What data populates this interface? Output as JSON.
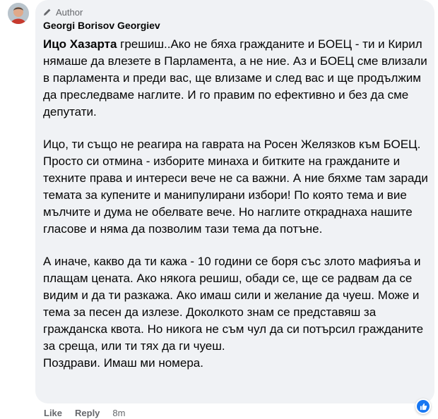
{
  "comment": {
    "author_badge": "Author",
    "author_name": "Georgi Borisov Georgiev",
    "mention": "Ицо Хазарта",
    "paragraphs": [
      "грешиш..Ако не бяха гражданите и БОЕЦ - ти и Кирил нямаше да влезете в Парламента, а не ние. Аз и БОЕЦ сме влизали в парламента и преди вас, ще влизаме и след вас и ще продължим да преследваме наглите. И го правим по ефективно и без да сме депутати.",
      "Ицо, ти също не реагира на гаврата на Росен Желязков към БОЕЦ. Просто си отмина - изборите минаха и битките на гражданите и техните права и интереси вече не са важни. А ние бяхме там заради темата за купените и манипулирани избори! По която тема и вие мълчите и дума не обелвате вече. Но наглите откраднаха нашите гласове и няма да позволим тази тема да потъне.",
      "А иначе, какво да ти кажа - 10 години се боря със злото мафияъа и плащам цената. Ако някога решиш, обади се, ще се радвам да се видим и да ти разкажа. Ако имаш сили и желание да чуеш. Може и тема за песен да излезе. Доколкото знам се представяш за гражданска квота. Но никога не съм чул да си потърсил гражданите за среща, или ти тях да ги чуеш.",
      "Поздрави. Имаш ми номера."
    ]
  },
  "actions": {
    "like_label": "Like",
    "reply_label": "Reply",
    "timestamp": "8m"
  },
  "icons": {
    "author_badge_icon": "pencil-icon",
    "reaction_icon": "thumbs-up-icon"
  },
  "colors": {
    "bubble_bg": "#f0f2f5",
    "secondary_text": "#65676b",
    "primary_text": "#050505",
    "like_blue": "#1877f2"
  }
}
